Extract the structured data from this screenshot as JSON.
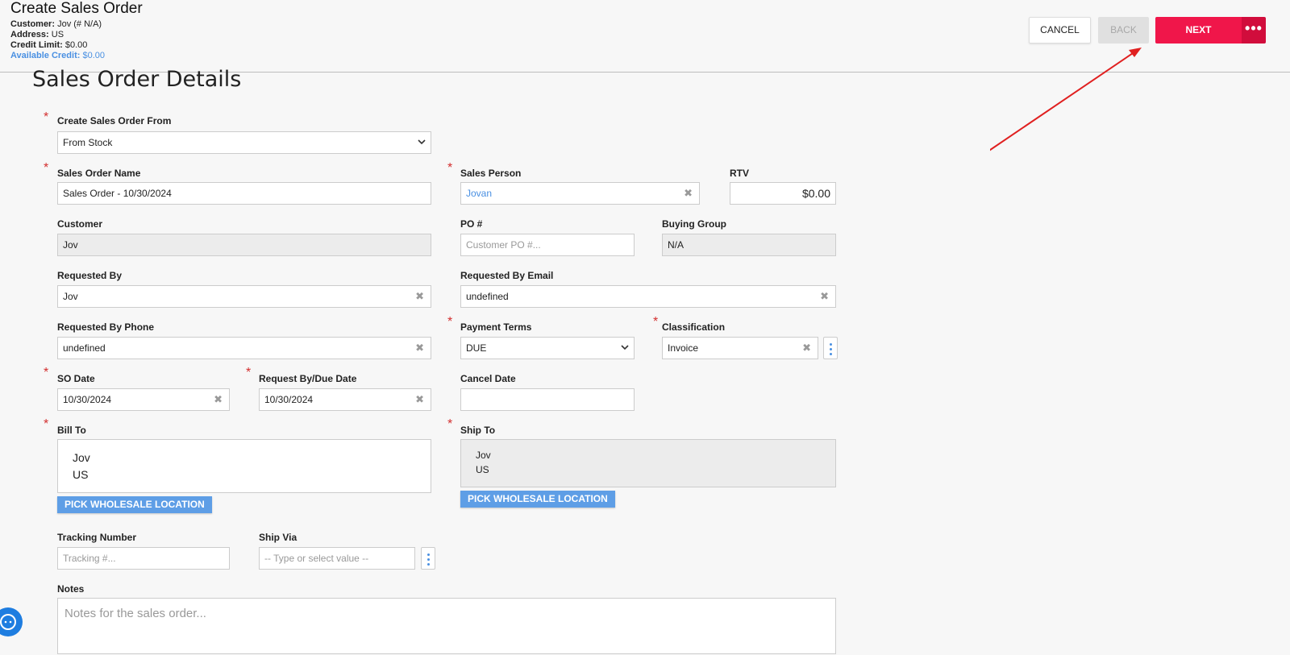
{
  "header": {
    "title": "Create Sales Order",
    "customer_label": "Customer:",
    "customer_value": "Jov (# N/A)",
    "address_label": "Address:",
    "address_value": "US",
    "credit_limit_label": "Credit Limit:",
    "credit_limit_value": "$0.00",
    "available_credit_label": "Available Credit:",
    "available_credit_value": "$0.00"
  },
  "actions": {
    "cancel": "CANCEL",
    "back": "BACK",
    "next": "NEXT",
    "more": "•••"
  },
  "section_title": "Sales Order Details",
  "form": {
    "create_from": {
      "label": "Create Sales Order From",
      "value": "From Stock"
    },
    "so_name": {
      "label": "Sales Order Name",
      "value": "Sales Order - 10/30/2024"
    },
    "sales_person": {
      "label": "Sales Person",
      "value": "Jovan"
    },
    "rtv": {
      "label": "RTV",
      "value": "$0.00"
    },
    "customer": {
      "label": "Customer",
      "value": "Jov"
    },
    "po": {
      "label": "PO #",
      "placeholder": "Customer PO #..."
    },
    "buying_group": {
      "label": "Buying Group",
      "value": "N/A"
    },
    "requested_by": {
      "label": "Requested By",
      "value": "Jov"
    },
    "requested_by_email": {
      "label": "Requested By Email",
      "value": "undefined"
    },
    "requested_by_phone": {
      "label": "Requested By Phone",
      "value": "undefined"
    },
    "payment_terms": {
      "label": "Payment Terms",
      "value": "DUE"
    },
    "classification": {
      "label": "Classification",
      "value": "Invoice"
    },
    "so_date": {
      "label": "SO Date",
      "value": "10/30/2024"
    },
    "due_date": {
      "label": "Request By/Due Date",
      "value": "10/30/2024"
    },
    "cancel_date": {
      "label": "Cancel Date",
      "value": ""
    },
    "bill_to": {
      "label": "Bill To",
      "line1": "Jov",
      "line2": "US",
      "button": "PICK WHOLESALE LOCATION"
    },
    "ship_to": {
      "label": "Ship To",
      "line1": "Jov",
      "line2": "US",
      "button": "PICK WHOLESALE LOCATION"
    },
    "tracking": {
      "label": "Tracking Number",
      "placeholder": "Tracking #..."
    },
    "ship_via": {
      "label": "Ship Via",
      "placeholder": "-- Type or select value --"
    },
    "notes": {
      "label": "Notes",
      "placeholder": "Notes for the sales order..."
    }
  },
  "colors": {
    "next": "#f0164a",
    "more": "#d10d3c",
    "link": "#4a90e2",
    "pick_button": "#5e9ee6",
    "required": "#d32f2f",
    "arrow": "#e02020"
  },
  "icons": [
    "clear-icon",
    "chevron-down-icon",
    "kebab-icon",
    "more-dots-icon",
    "support-chat-icon",
    "annotation-arrow"
  ]
}
